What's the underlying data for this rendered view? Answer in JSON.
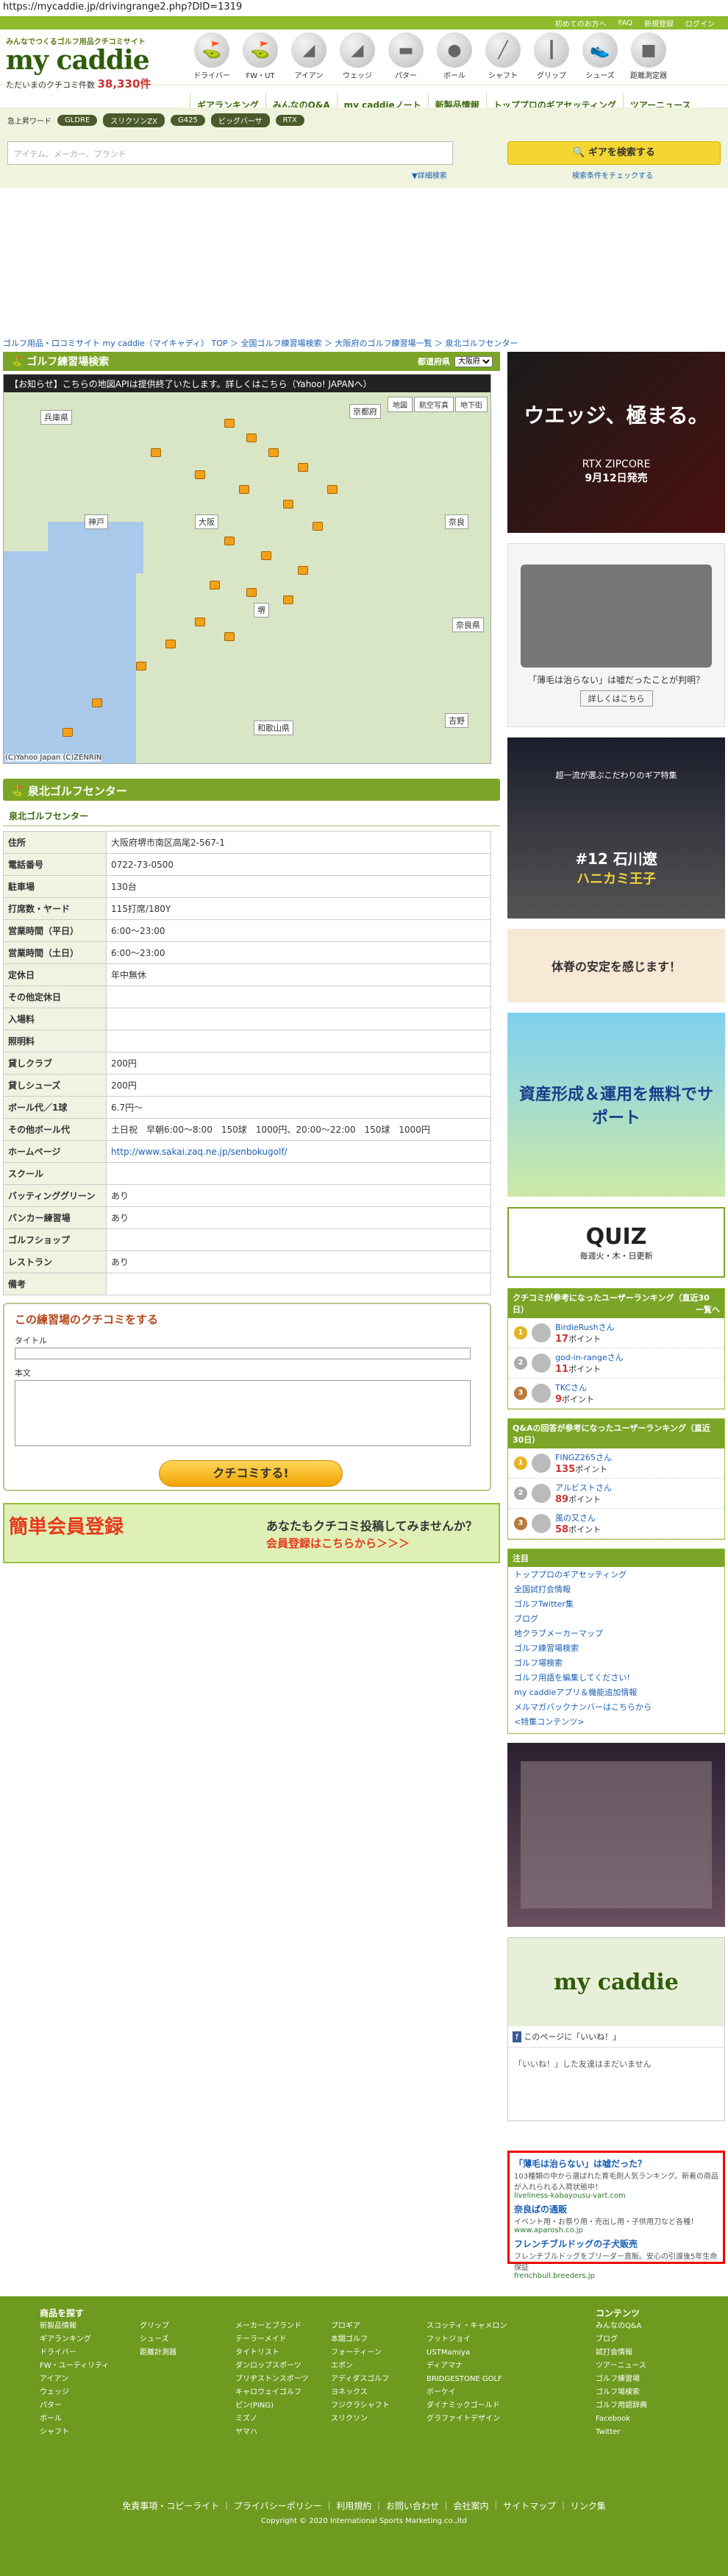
{
  "browser": {
    "url": "https://mycaddie.jp/drivingrange2.php?DID=1319"
  },
  "topbar": {
    "items": [
      "初めてのお方へ",
      "FAQ",
      "新規登録",
      "ログイン"
    ]
  },
  "logo": {
    "sub": "みんなでつくるゴルフ用品クチコミサイト",
    "main": "my caddie",
    "count_label": "ただいまのクチコミ件数",
    "count": "38,330件"
  },
  "categories": [
    "ドライバー",
    "FW・UT",
    "アイアン",
    "ウェッジ",
    "パター",
    "ボール",
    "シャフト",
    "グリップ",
    "シューズ",
    "距離測定器"
  ],
  "subnav": [
    "ギアランキング",
    "みんなのQ&A",
    "my caddieノート",
    "新製品情報",
    "トッププロのギアセッティング",
    "ツアーニュース"
  ],
  "search": {
    "kw_label": "急上昇ワード",
    "keywords": [
      "GLDRE",
      "スリクソンZX",
      "G425",
      "ビッグバーサ",
      "RTX"
    ],
    "placeholder": "アイテム、メーカー、ブランド",
    "button": "ギアを検索する",
    "detail": "▼詳細検索",
    "tips": "検索条件をチェックする"
  },
  "breadcrumb": "ゴルフ用品・口コミサイト my caddie（マイキャディ） TOP ＞ 全国ゴルフ練習場検索 ＞ 大阪府のゴルフ練習場一覧 ＞ 泉北ゴルフセンター",
  "section": {
    "title": "ゴルフ練習場検索",
    "region_label": "都道府県",
    "region": "大阪府"
  },
  "map": {
    "notice": "【お知らせ】こちらの地図APIは提供終了いたします。詳しくはこちら（Yahoo! JAPANへ）",
    "controls": [
      "地図",
      "航空写真",
      "地下街"
    ],
    "cities": [
      "兵庫県",
      "神戸",
      "大阪",
      "奈良",
      "堺",
      "和歌山県",
      "吉野",
      "奈良県",
      "京都府"
    ],
    "footer": "(C)Yahoo Japan (C)ZENRIN"
  },
  "place": {
    "name": "泉北ゴルフセンター",
    "sub": "泉北ゴルフセンター"
  },
  "info": [
    {
      "k": "住所",
      "v": "大阪府堺市南区高尾2-567-1"
    },
    {
      "k": "電話番号",
      "v": "0722-73-0500"
    },
    {
      "k": "駐車場",
      "v": "130台"
    },
    {
      "k": "打席数・ヤード",
      "v": "115打席/180Y"
    },
    {
      "k": "営業時間（平日）",
      "v": "6:00～23:00"
    },
    {
      "k": "営業時間（土日）",
      "v": "6:00～23:00"
    },
    {
      "k": "定休日",
      "v": "年中無休"
    },
    {
      "k": "その他定休日",
      "v": ""
    },
    {
      "k": "入場料",
      "v": ""
    },
    {
      "k": "照明料",
      "v": ""
    },
    {
      "k": "貸しクラブ",
      "v": "200円"
    },
    {
      "k": "貸しシューズ",
      "v": "200円"
    },
    {
      "k": "ボール代／1球",
      "v": "6.7円～"
    },
    {
      "k": "その他ボール代",
      "v": "土日祝　早朝6:00～8:00　150球　1000円、20:00～22:00　150球　1000円"
    },
    {
      "k": "ホームページ",
      "v": "http://www.sakai.zaq.ne.jp/senbokugolf/"
    },
    {
      "k": "スクール",
      "v": ""
    },
    {
      "k": "バッティンググリーン",
      "v": "あり"
    },
    {
      "k": "バンカー練習場",
      "v": "あり"
    },
    {
      "k": "ゴルフショップ",
      "v": ""
    },
    {
      "k": "レストラン",
      "v": "あり"
    },
    {
      "k": "備考",
      "v": ""
    }
  ],
  "review": {
    "title": "この練習場のクチコミをする",
    "title_label": "タイトル",
    "body_label": "本文",
    "button": "クチコミする!"
  },
  "banner": {
    "left": "簡単会員登録",
    "line1": "あなたもクチコミ投稿してみませんか？",
    "line2": "会員登録はこちらから＞＞＞"
  },
  "ads": {
    "a1_title": "ウエッジ、極まる。",
    "a1_sub": "RTX ZIPCORE",
    "a1_date": "9月12日発売",
    "a2_text": "「薄毛は治らない」は嘘だったことが判明？",
    "a2_btn": "詳しくはこちら",
    "a3_text": "超一流が選ぶこだわりのギア特集",
    "a3_name": "#12 石川遼",
    "a3_sub": "ハニカミ王子",
    "a4_text": "体脊の安定を感じます！",
    "a5_title": "資産形成＆運用を無料でサポート",
    "a6_title": "QUIZ",
    "a6_sub": "毎週火・木・日更新"
  },
  "ranking1": {
    "title": "クチコミが参考になったユーザーランキング（直近30日）",
    "more": "一覧へ",
    "users": [
      {
        "name": "BirdieRushさん",
        "pt": "17",
        "unit": "ポイント"
      },
      {
        "name": "god-in-rangeさん",
        "pt": "11",
        "unit": "ポイント"
      },
      {
        "name": "TKCさん",
        "pt": "9",
        "unit": "ポイント"
      }
    ]
  },
  "ranking2": {
    "title": "Q&Aの回答が参考になったユーザーランキング（直近30日）",
    "users": [
      {
        "name": "FINGZ265さん",
        "pt": "135",
        "unit": "ポイント"
      },
      {
        "name": "アルビストさん",
        "pt": "89",
        "unit": "ポイント"
      },
      {
        "name": "風の又さん",
        "pt": "58",
        "unit": "ポイント"
      }
    ]
  },
  "links": {
    "title": "注目",
    "items": [
      "トッププロのギアセッティング",
      "全国試打会情報",
      "ゴルフTwitter集",
      "ブログ",
      "地クラブメーカーマップ",
      "ゴルフ練習場検索",
      "ゴルフ場検索",
      "ゴルフ用語を編集してください!",
      "my caddieアプリ＆機能追加情報",
      "メルマガバックナンバーはこちらから",
      "<特集コンテンツ>"
    ]
  },
  "fb": {
    "name": "my caddie",
    "like": "このページに「いいね！」",
    "friends": "「いいね！」した友達はまだいません"
  },
  "textads": [
    {
      "title": "「薄毛は治らない」は嘘だった？",
      "desc": "103種類の中から選ばれた育毛剤人気ランキング。新着の商品が入れられる入荷状態中！",
      "url": "liveliness-kabayousu-vart.com"
    },
    {
      "title": "奈良ばの通販",
      "desc": "イベント用・お祭り用・売出し用・子供用刀など各種！",
      "url": "www.aparosh.co.jp"
    },
    {
      "title": "フレンチブルドッグの子犬販売",
      "desc": "フレンチブルドッグをブリーダー直販。安心の引渡後5年生命保証",
      "url": "frenchbull.breeders.jp"
    }
  ],
  "footer": {
    "head1": "商品を探す",
    "head2": "コンテンツ",
    "col1": [
      "新製品情報",
      "ギアランキング",
      "ドライバー",
      "FW・ユーティリティ",
      "アイアン",
      "ウェッジ",
      "パター",
      "ボール",
      "シャフト"
    ],
    "col2": [
      "グリップ",
      "シューズ",
      "距離計測器"
    ],
    "col3": [
      "メーカーとブランド",
      "テーラーメイド",
      "タイトリスト",
      "ダンロップスポーツ",
      "ブリヂストンスポーツ",
      "キャロウェイゴルフ",
      "ピン(PING)",
      "ミズノ",
      "ヤマハ"
    ],
    "col4": [
      "プロギア",
      "本間ゴルフ",
      "フォーティーン",
      "エポン",
      "アディダスゴルフ",
      "ヨネックス",
      "フジクラシャフト",
      "スリクソン"
    ],
    "col5": [
      "スコッティ・キャメロン",
      "フットジョイ",
      "USTMamiya",
      "ディアマナ",
      "BRIDGESTONE GOLF",
      "ボーケイ",
      "ダイナミックゴールド",
      "グラファイトデザイン"
    ],
    "col6": [
      "みんなのQ&A",
      "ブログ",
      "試打会情報",
      "ツアーニュース",
      "ゴルフ練習場",
      "ゴルフ場検索",
      "ゴルフ用語辞典",
      "Facebook",
      "Twitter"
    ],
    "links": "免責事項・コピーライト ｜ プライバシーポリシー ｜ 利用規約 ｜ お問い合わせ ｜ 会社案内 ｜ サイトマップ ｜ リンク集",
    "copyright": "Copyright © 2020 International Sports Marketing.co.,ltd"
  }
}
